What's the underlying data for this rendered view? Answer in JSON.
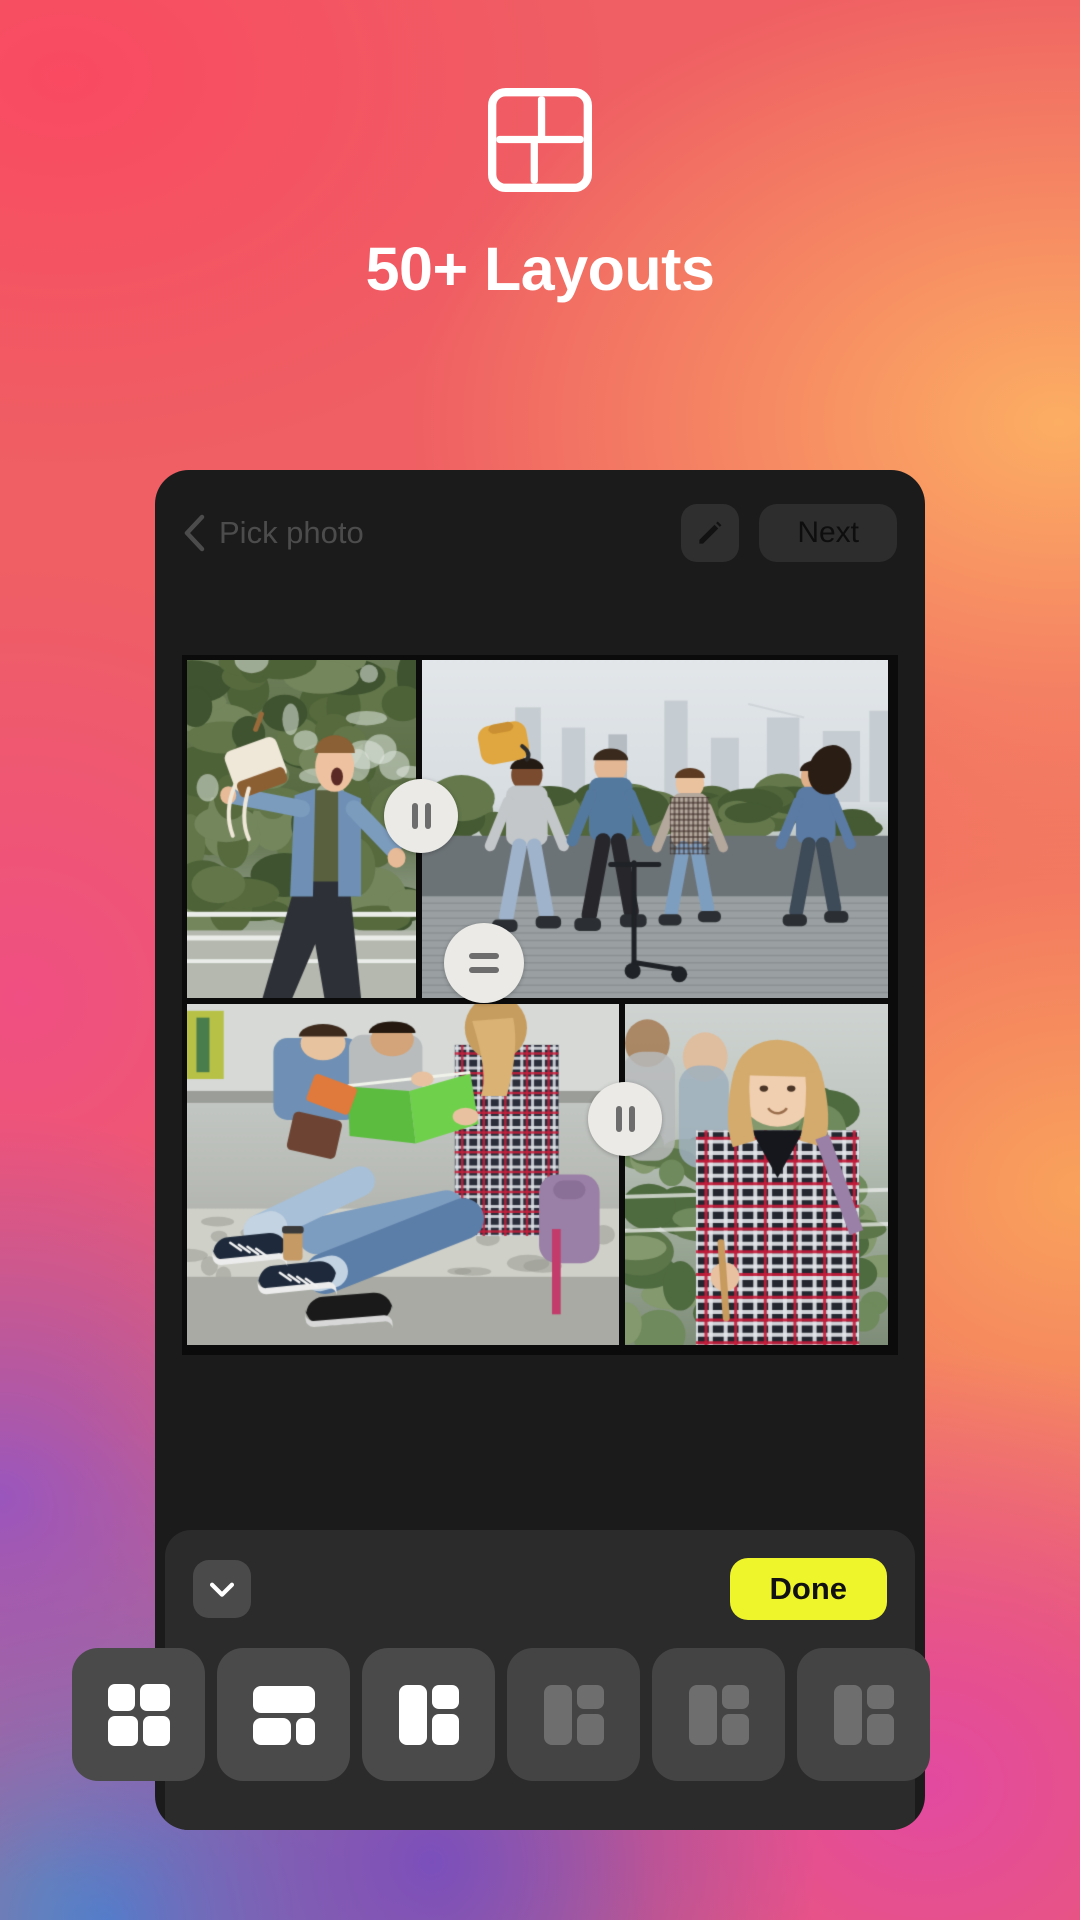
{
  "hero": {
    "icon": "layout-grid-icon",
    "title": "50+ Layouts"
  },
  "colors": {
    "accent_yellow": "#eef52b",
    "phone_bg": "#1b1b1b",
    "sheet_bg": "#2b2b2b",
    "thumb_bg": "#4a4a4a",
    "nav_text": "#4c4c4c",
    "handle_fill": "#ebeae6",
    "bg_top_left": "#f4555f",
    "bg_top_right": "#fcae63",
    "bg_bottom_left": "#4e84cc",
    "bg_bottom_right": "#e24aa0"
  },
  "phone": {
    "navbar": {
      "back_icon": "chevron-left-icon",
      "title": "Pick photo",
      "edit_icon": "pencil-icon",
      "next_label": "Next"
    },
    "collage": {
      "cells": [
        {
          "id": "cell-top-left",
          "caption": "boy-throwing-backpack"
        },
        {
          "id": "cell-top-right",
          "caption": "friends-running-scooter"
        },
        {
          "id": "cell-bottom-left",
          "caption": "students-reading-green-book"
        },
        {
          "id": "cell-bottom-right",
          "caption": "blonde-girl-plaid-shirt"
        }
      ],
      "handles": [
        {
          "id": "handle-vertical-top",
          "icon": "pause-bars-icon",
          "orientation": "vertical"
        },
        {
          "id": "handle-horizontal-middle",
          "icon": "equals-bars-icon",
          "orientation": "horizontal"
        },
        {
          "id": "handle-vertical-bottom",
          "icon": "pause-bars-icon",
          "orientation": "vertical"
        }
      ]
    },
    "sheet": {
      "collapse_icon": "chevron-down-icon",
      "done_label": "Done"
    },
    "layout_thumbnails": [
      {
        "id": "layout-1",
        "name": "grid-2x2-offset",
        "state": "active"
      },
      {
        "id": "layout-2",
        "name": "top-wide-bottom-split",
        "state": "active"
      },
      {
        "id": "layout-3",
        "name": "left-tall-right-split",
        "state": "active"
      },
      {
        "id": "layout-4",
        "name": "left-tall-right-split",
        "state": "dim"
      },
      {
        "id": "layout-5",
        "name": "left-tall-right-split",
        "state": "dim"
      },
      {
        "id": "layout-6",
        "name": "left-tall-right-split",
        "state": "dim"
      }
    ]
  }
}
